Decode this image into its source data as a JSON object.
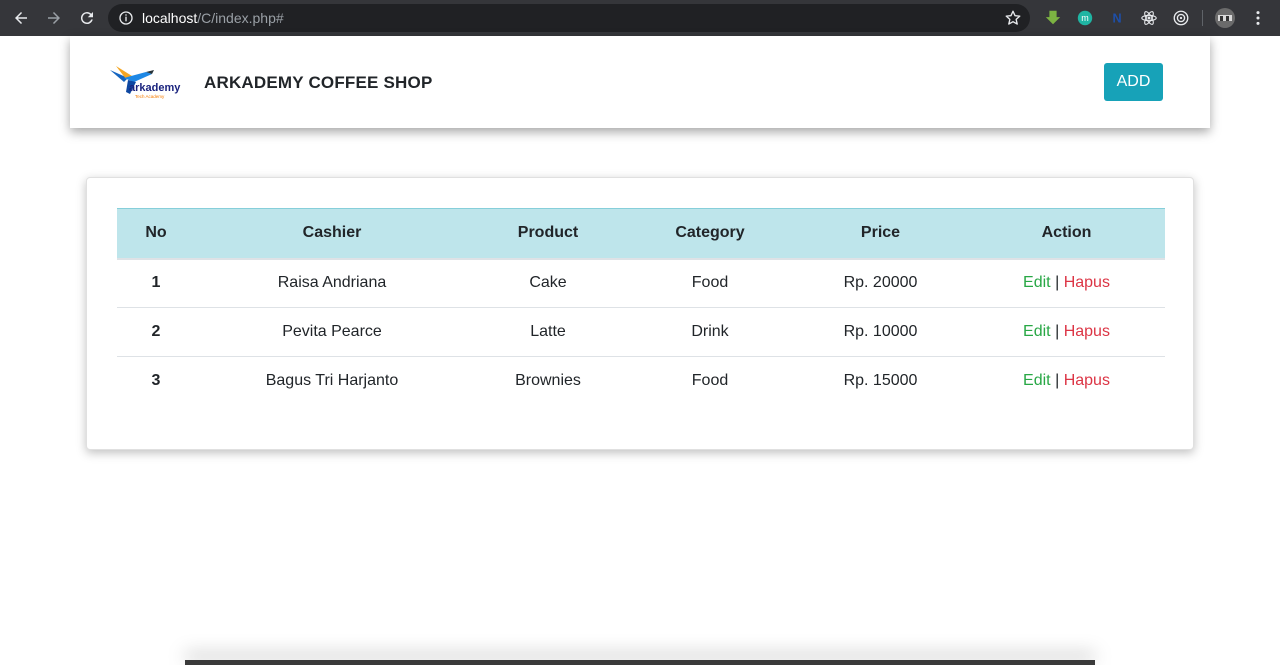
{
  "browser": {
    "url_host": "localhost",
    "url_path": "/C/index.php#",
    "icons": [
      "back-icon",
      "forward-icon",
      "reload-icon",
      "info-icon",
      "star-icon",
      "download-extension-icon",
      "m-extension-icon",
      "n-extension-icon",
      "react-extension-icon",
      "target-extension-icon",
      "profile-avatar",
      "menu-icon"
    ]
  },
  "navbar": {
    "brand": "ARKADEMY COFFEE SHOP",
    "logo_text": "arkademy",
    "logo_subtext": "Tech Academy",
    "add_label": "ADD"
  },
  "table": {
    "headers": [
      "No",
      "Cashier",
      "Product",
      "Category",
      "Price",
      "Action"
    ],
    "rows": [
      {
        "no": "1",
        "cashier": "Raisa Andriana",
        "product": "Cake",
        "category": "Food",
        "price": "Rp. 20000",
        "edit": "Edit",
        "sep": "|",
        "delete": "Hapus"
      },
      {
        "no": "2",
        "cashier": "Pevita Pearce",
        "product": "Latte",
        "category": "Drink",
        "price": "Rp. 10000",
        "edit": "Edit",
        "sep": "|",
        "delete": "Hapus"
      },
      {
        "no": "3",
        "cashier": "Bagus Tri Harjanto",
        "product": "Brownies",
        "category": "Food",
        "price": "Rp. 15000",
        "edit": "Edit",
        "sep": "|",
        "delete": "Hapus"
      }
    ]
  },
  "colors": {
    "header_bg": "#bee5eb",
    "add_button": "#17a2b8",
    "edit": "#28a745",
    "delete": "#dc3545"
  }
}
